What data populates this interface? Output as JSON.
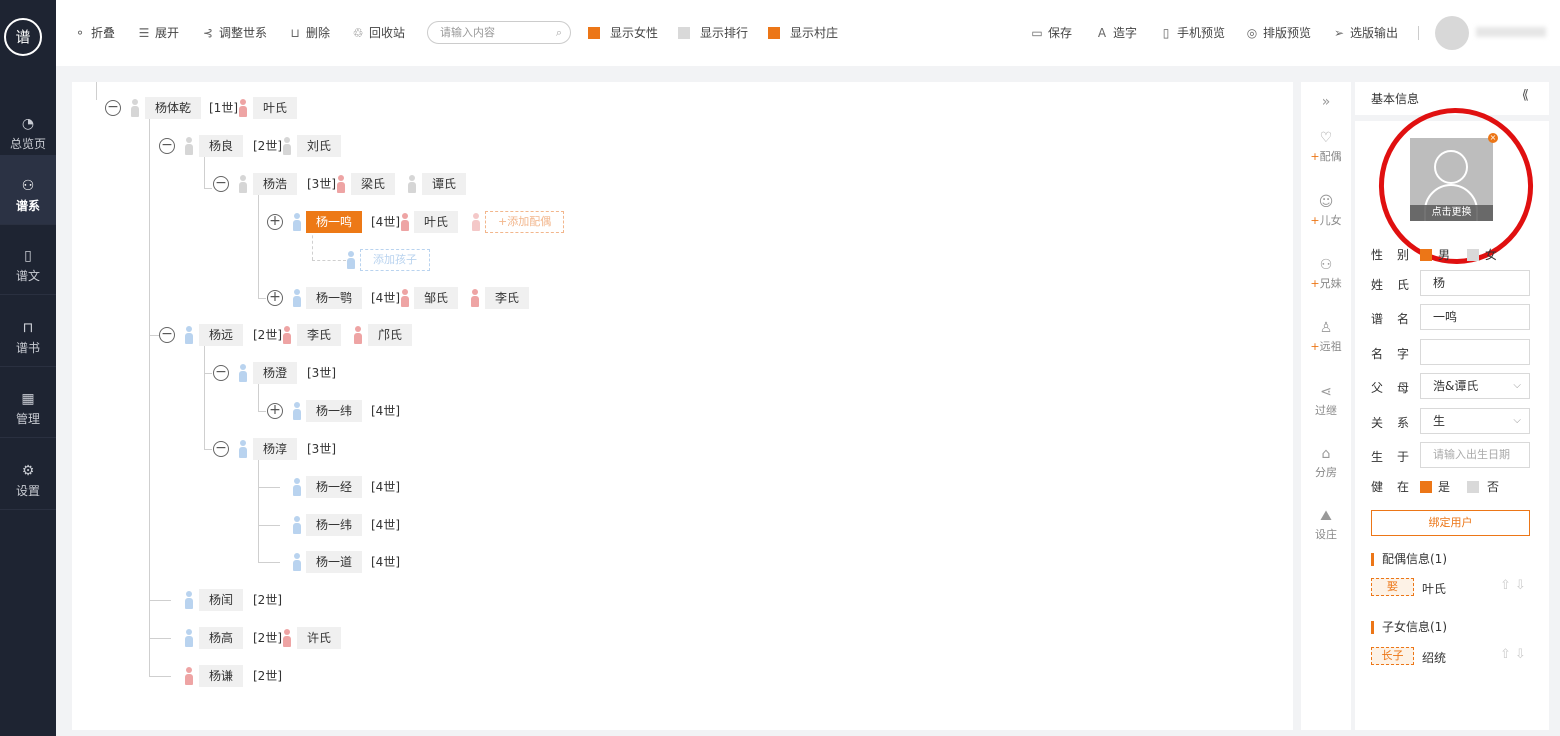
{
  "sidebar": {
    "logo": "谱",
    "items": [
      {
        "label": "总览页",
        "icon": "dashboard-icon",
        "glyph": "◔"
      },
      {
        "label": "谱系",
        "icon": "tree-icon",
        "glyph": "⚇"
      },
      {
        "label": "谱文",
        "icon": "document-icon",
        "glyph": "▯"
      },
      {
        "label": "谱书",
        "icon": "book-icon",
        "glyph": "⊓"
      },
      {
        "label": "管理",
        "icon": "grid-icon",
        "glyph": "▦"
      },
      {
        "label": "设置",
        "icon": "gear-icon",
        "glyph": "⚙"
      }
    ]
  },
  "toolbar": {
    "fold": "折叠",
    "expand": "展开",
    "adjust": "调整世系",
    "delete": "删除",
    "recycle": "回收站",
    "search_placeholder": "请输入内容",
    "show_female": "显示女性",
    "show_rank": "显示排行",
    "show_village": "显示村庄",
    "show_female_checked": true,
    "show_rank_checked": false,
    "show_village_checked": true,
    "save": "保存",
    "make_char": "造字",
    "mobile_preview": "手机预览",
    "layout_preview": "排版预览",
    "export": "选版输出"
  },
  "tree": {
    "g1": {
      "name": "杨体乾",
      "gen": "[1世]",
      "spouse": "叶氏"
    },
    "g2a": {
      "name": "杨良",
      "gen": "[2世]",
      "spouse": "刘氏"
    },
    "g3a": {
      "name": "杨浩",
      "gen": "[3世]",
      "spouse1": "梁氏",
      "spouse2": "谭氏"
    },
    "g4a": {
      "name": "杨一鸣",
      "gen": "[4世]",
      "spouse": "叶氏",
      "add_spouse": "+添加配偶",
      "add_child": "添加孩子"
    },
    "g4b": {
      "name": "杨一鹗",
      "gen": "[4世]",
      "spouse1": "邹氏",
      "spouse2": "李氏"
    },
    "g2b": {
      "name": "杨远",
      "gen": "[2世]",
      "spouse1": "李氏",
      "spouse2": "邝氏"
    },
    "g3b": {
      "name": "杨澄",
      "gen": "[3世]"
    },
    "g4c": {
      "name": "杨一纬",
      "gen": "[4世]"
    },
    "g3c": {
      "name": "杨淳",
      "gen": "[3世]"
    },
    "g4d": {
      "name": "杨一经",
      "gen": "[4世]"
    },
    "g4e": {
      "name": "杨一纬",
      "gen": "[4世]"
    },
    "g4f": {
      "name": "杨一道",
      "gen": "[4世]"
    },
    "g2c": {
      "name": "杨闰",
      "gen": "[2世]"
    },
    "g2d": {
      "name": "杨高",
      "gen": "[2世]",
      "spouse": "许氏"
    },
    "g2e": {
      "name": "杨谦",
      "gen": "[2世]"
    }
  },
  "actions": [
    {
      "label": "配偶",
      "plus": "+",
      "icon": "heart-icon",
      "glyph": "♡"
    },
    {
      "label": "儿女",
      "plus": "+",
      "icon": "child-icon",
      "glyph": "☺"
    },
    {
      "label": "兄妹",
      "plus": "+",
      "icon": "siblings-icon",
      "glyph": "⚇"
    },
    {
      "label": "远祖",
      "plus": "+",
      "icon": "ancestor-icon",
      "glyph": "♙"
    },
    {
      "label": "过继",
      "plus": "",
      "icon": "share-icon",
      "glyph": "⋖"
    },
    {
      "label": "分房",
      "plus": "",
      "icon": "house-icon",
      "glyph": "⌂"
    },
    {
      "label": "设庄",
      "plus": "",
      "icon": "landscape-icon",
      "glyph": "⛰"
    }
  ],
  "panel": {
    "title": "基本信息",
    "photo_caption": "点击更换",
    "gender_label": "性别",
    "gender_male": "男",
    "gender_female": "女",
    "surname_label": "姓氏",
    "surname": "杨",
    "pu_name_label": "谱名",
    "pu_name": "一鸣",
    "given_name_label": "名字",
    "given_name": "",
    "parents_label": "父母",
    "parents": "浩&谭氏",
    "relation_label": "关系",
    "relation": "生",
    "born_label": "生于",
    "born_placeholder": "请输入出生日期",
    "alive_label": "健在",
    "alive_yes": "是",
    "alive_no": "否",
    "bind_user": "绑定用户",
    "spouse_section": "配偶信息(1)",
    "spouse_tag": "娶",
    "spouse_name": "叶氏",
    "children_section": "子女信息(1)",
    "child_tag": "长子",
    "child_name": "绍统"
  },
  "colors": {
    "accent": "#ec7617",
    "sidebar": "#1e2432",
    "male": "#b9d3ef",
    "female": "#eea4a4",
    "annotation": "#e01010"
  }
}
